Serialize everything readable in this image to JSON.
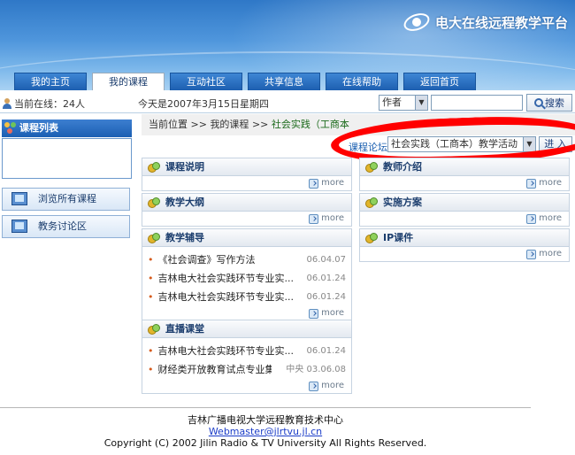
{
  "header": {
    "site_title": "电大在线远程教学平台",
    "tabs": [
      {
        "label": "我的主页",
        "active": false
      },
      {
        "label": "我的课程",
        "active": true
      },
      {
        "label": "互动社区",
        "active": false
      },
      {
        "label": "共享信息",
        "active": false
      },
      {
        "label": "在线帮助",
        "active": false
      },
      {
        "label": "返回首页",
        "active": false
      }
    ]
  },
  "infobar": {
    "online_text": "当前在线：24人",
    "date_text": "今天是2007年3月15日星期四",
    "search_field": "作者",
    "search_value": "",
    "search_button": "搜索"
  },
  "sidebar": {
    "course_list_title": "课程列表",
    "buttons": [
      "浏览所有课程",
      "教务讨论区"
    ]
  },
  "breadcrumb": {
    "prefix": "当前位置",
    "sep": ">>",
    "level1": "我的课程",
    "current": "社会实践（工商本"
  },
  "forum": {
    "label": "课程论坛",
    "selected": "社会实践（工商本）教学活动",
    "enter_button": "进 入"
  },
  "panels": {
    "more_label": "more",
    "course_desc": {
      "title": "课程说明",
      "items": []
    },
    "syllabus": {
      "title": "教学大纲",
      "items": []
    },
    "tutoring": {
      "title": "教学辅导",
      "items": [
        {
          "text": "《社会调查》写作方法",
          "date": "06.04.07"
        },
        {
          "text": "吉林电大社会实践环节专业实...",
          "date": "06.01.24"
        },
        {
          "text": "吉林电大社会实践环节专业实...",
          "date": "06.01.24"
        }
      ]
    },
    "live": {
      "title": "直播课堂",
      "items": [
        {
          "text": "吉林电大社会实践环节专业实...",
          "date": "06.01.24"
        },
        {
          "text": "财经类开放教育试点专业集中...",
          "extra": "中央",
          "date": "03.06.08"
        }
      ]
    },
    "teacher_intro": {
      "title": "教师介绍",
      "items": []
    },
    "implementation": {
      "title": "实施方案",
      "items": []
    },
    "ip_courseware": {
      "title": "IP课件",
      "items": []
    }
  },
  "footer": {
    "center_name": "吉林广播电视大学远程教育技术中心",
    "email": "Webmaster@jlrtvu.jl.cn",
    "copyright": "Copyright (C) 2002    Jilin Radio & TV University    All Rights Reserved."
  },
  "colors": {
    "banner_blue": "#2f78c7",
    "tab_blue": "#1d5fb0",
    "highlight_red": "#ff0000"
  }
}
